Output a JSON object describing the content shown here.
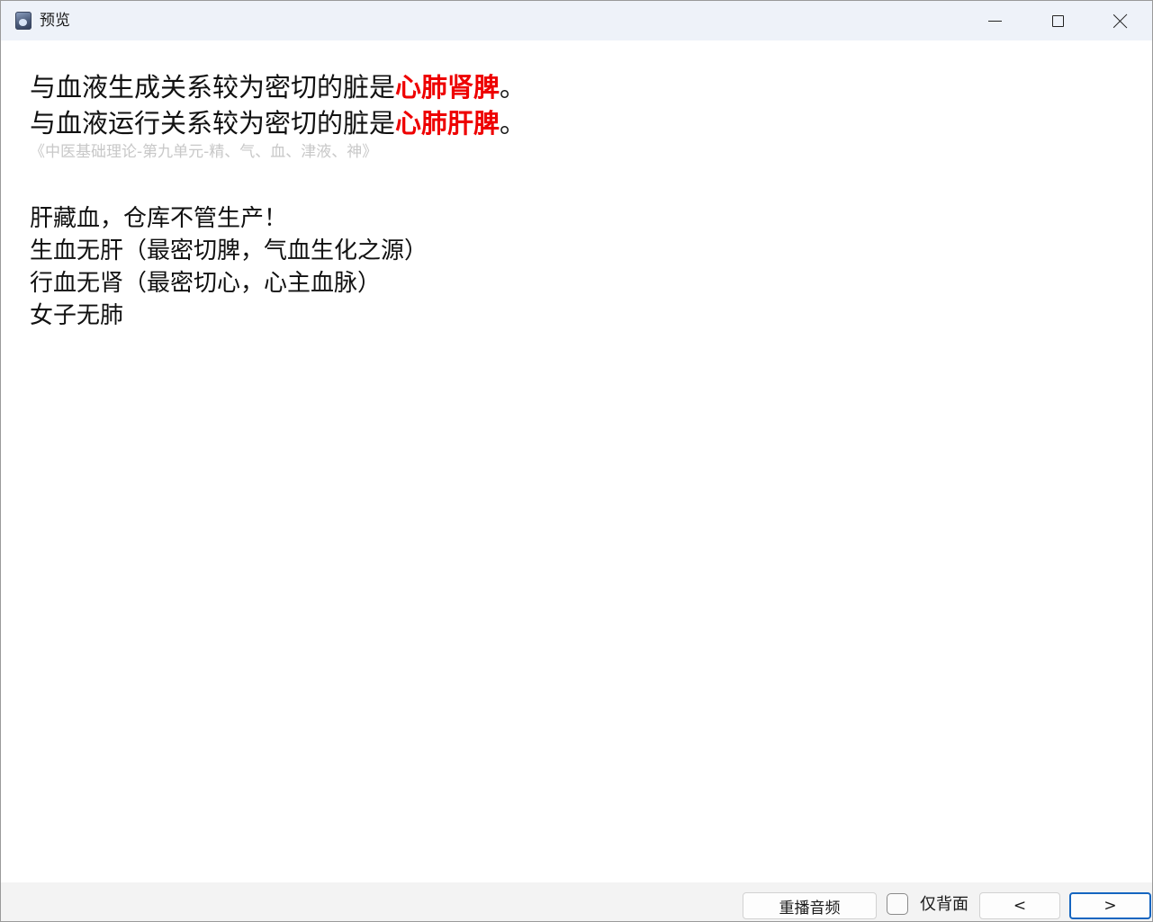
{
  "window": {
    "title": "预览"
  },
  "content": {
    "answer_lines": [
      {
        "prefix": "与血液生成关系较为密切的脏是",
        "highlight": "心肺肾脾",
        "suffix": "。"
      },
      {
        "prefix": "与血液运行关系较为密切的脏是",
        "highlight": "心肺肝脾",
        "suffix": "。"
      }
    ],
    "source": "《中医基础理论-第九单元-精、气、血、津液、神》",
    "notes": [
      "肝藏血，仓库不管生产！",
      "生血无肝（最密切脾，气血生化之源）",
      "行血无肾（最密切心，心主血脉）",
      "女子无肺"
    ],
    "highlight_color": "#ee0000"
  },
  "footer": {
    "replay_label": "重播音频",
    "back_only_label": "仅背面",
    "back_only_checked": false,
    "prev_label": "<",
    "next_label": ">"
  },
  "icons": {
    "app": "app-icon",
    "minimize": "minimize-icon",
    "maximize": "maximize-icon",
    "close": "close-icon"
  }
}
